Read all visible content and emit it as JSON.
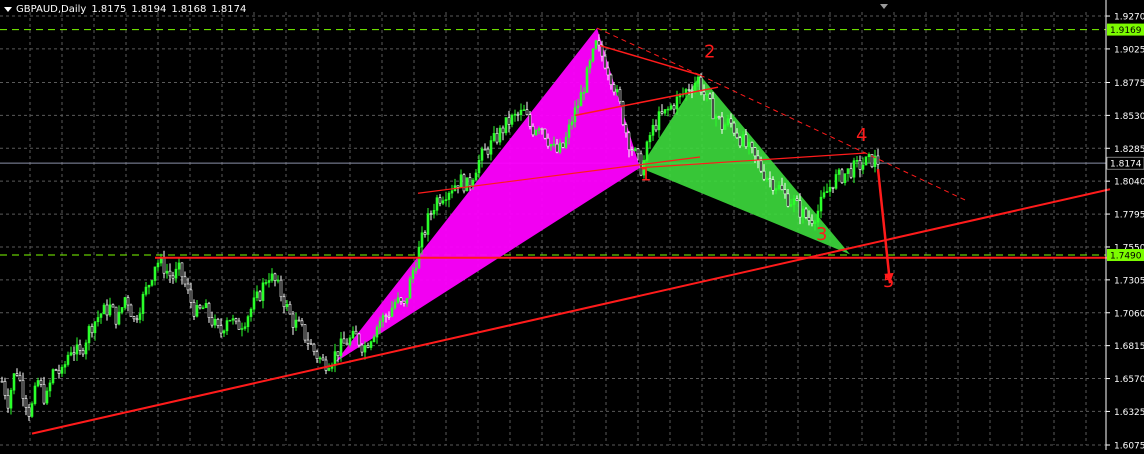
{
  "header": {
    "symbol_tf": "GBPAUD,Daily",
    "open": "1.8175",
    "high": "1.8194",
    "low": "1.8168",
    "close": "1.8174"
  },
  "colors": {
    "background": "#000000",
    "grid": "#5a5a5a",
    "bull_candle": "#2bff2b",
    "bear_candle": "#ffffff",
    "trend_line": "#ff1b1b",
    "xabcd_pink": "#ff00ff",
    "xabcd_green": "#3ddc3d",
    "hline_green": "#7cfc00",
    "price_label": "#c8c8c8",
    "axis_text": "#ffffff"
  },
  "chart_data": {
    "type": "candlestick",
    "ylim": [
      1.6075,
      1.93
    ],
    "y_ticks": [
      "1.9270",
      "1.9025",
      "1.8775",
      "1.8530",
      "1.8285",
      "1.8040",
      "1.7795",
      "1.7550",
      "1.7305",
      "1.7060",
      "1.6815",
      "1.6570",
      "1.6325",
      "1.6075"
    ],
    "grid": true,
    "current_price": "1.8174",
    "price_levels": [
      {
        "label": "1.9169",
        "value": 1.9169,
        "style": "dashed"
      },
      {
        "label": "1.7490",
        "value": 1.749,
        "style": "dashed"
      }
    ],
    "close_path": [
      [
        0,
        1.66
      ],
      [
        8,
        1.64
      ],
      [
        16,
        1.665
      ],
      [
        22,
        1.65
      ],
      [
        30,
        1.63
      ],
      [
        38,
        1.655
      ],
      [
        46,
        1.64
      ],
      [
        54,
        1.665
      ],
      [
        62,
        1.66
      ],
      [
        70,
        1.68
      ],
      [
        80,
        1.675
      ],
      [
        90,
        1.695
      ],
      [
        100,
        1.705
      ],
      [
        110,
        1.71
      ],
      [
        118,
        1.7
      ],
      [
        126,
        1.72
      ],
      [
        134,
        1.7
      ],
      [
        142,
        1.715
      ],
      [
        150,
        1.73
      ],
      [
        156,
        1.745
      ],
      [
        164,
        1.74
      ],
      [
        172,
        1.732
      ],
      [
        180,
        1.738
      ],
      [
        188,
        1.72
      ],
      [
        196,
        1.705
      ],
      [
        204,
        1.71
      ],
      [
        212,
        1.7
      ],
      [
        220,
        1.69
      ],
      [
        228,
        1.705
      ],
      [
        236,
        1.695
      ],
      [
        244,
        1.7
      ],
      [
        252,
        1.71
      ],
      [
        260,
        1.72
      ],
      [
        268,
        1.735
      ],
      [
        276,
        1.728
      ],
      [
        284,
        1.715
      ],
      [
        292,
        1.7
      ],
      [
        300,
        1.695
      ],
      [
        308,
        1.685
      ],
      [
        316,
        1.675
      ],
      [
        324,
        1.668
      ],
      [
        332,
        1.672
      ],
      [
        340,
        1.68
      ],
      [
        348,
        1.685
      ],
      [
        356,
        1.688
      ],
      [
        364,
        1.68
      ],
      [
        372,
        1.69
      ],
      [
        380,
        1.7
      ],
      [
        388,
        1.705
      ],
      [
        396,
        1.715
      ],
      [
        404,
        1.71
      ],
      [
        412,
        1.735
      ],
      [
        420,
        1.755
      ],
      [
        428,
        1.775
      ],
      [
        436,
        1.79
      ],
      [
        444,
        1.795
      ],
      [
        452,
        1.8
      ],
      [
        460,
        1.805
      ],
      [
        468,
        1.8
      ],
      [
        476,
        1.815
      ],
      [
        484,
        1.825
      ],
      [
        492,
        1.832
      ],
      [
        500,
        1.84
      ],
      [
        508,
        1.848
      ],
      [
        516,
        1.852
      ],
      [
        524,
        1.855
      ],
      [
        532,
        1.842
      ],
      [
        540,
        1.848
      ],
      [
        548,
        1.835
      ],
      [
        556,
        1.825
      ],
      [
        564,
        1.83
      ],
      [
        572,
        1.85
      ],
      [
        580,
        1.865
      ],
      [
        588,
        1.885
      ],
      [
        596,
        1.905
      ],
      [
        604,
        1.895
      ],
      [
        612,
        1.88
      ],
      [
        620,
        1.86
      ],
      [
        628,
        1.835
      ],
      [
        636,
        1.822
      ],
      [
        642,
        1.812
      ],
      [
        650,
        1.838
      ],
      [
        658,
        1.85
      ],
      [
        666,
        1.855
      ],
      [
        674,
        1.862
      ],
      [
        682,
        1.868
      ],
      [
        690,
        1.875
      ],
      [
        698,
        1.88
      ],
      [
        706,
        1.865
      ],
      [
        714,
        1.855
      ],
      [
        722,
        1.845
      ],
      [
        730,
        1.848
      ],
      [
        738,
        1.838
      ],
      [
        746,
        1.83
      ],
      [
        754,
        1.822
      ],
      [
        762,
        1.812
      ],
      [
        770,
        1.805
      ],
      [
        778,
        1.8
      ],
      [
        786,
        1.792
      ],
      [
        794,
        1.788
      ],
      [
        802,
        1.78
      ],
      [
        810,
        1.775
      ],
      [
        818,
        1.782
      ],
      [
        826,
        1.795
      ],
      [
        834,
        1.805
      ],
      [
        842,
        1.808
      ],
      [
        850,
        1.812
      ],
      [
        858,
        1.815
      ],
      [
        866,
        1.818
      ],
      [
        874,
        1.82
      ],
      [
        880,
        1.8174
      ]
    ],
    "pattern": {
      "pink_triangle": [
        [
          335,
          1.669
        ],
        [
          597,
          1.918
        ],
        [
          640,
          1.814
        ]
      ],
      "green_triangle": [
        [
          640,
          1.814
        ],
        [
          700,
          1.883
        ],
        [
          850,
          1.7495
        ]
      ],
      "points": [
        {
          "label": "1",
          "x": 640,
          "y": 1.814,
          "text_x": 640,
          "text_y": 1.8045
        },
        {
          "label": "2",
          "x": 700,
          "y": 1.883,
          "text_x": 704,
          "text_y": 1.896
        },
        {
          "label": "3",
          "x": 850,
          "y": 1.7495,
          "text_x": 816,
          "text_y": 1.76
        },
        {
          "label": "4",
          "x": 866,
          "y": 1.825,
          "text_x": 856,
          "text_y": 1.834
        },
        {
          "label": "5",
          "x": 888,
          "y": 1.73,
          "text_x": 883,
          "text_y": 1.725
        }
      ]
    },
    "trend_lines": [
      {
        "from": [
          32,
          1.616
        ],
        "to": [
          1110,
          1.798
        ],
        "width": 2
      },
      {
        "from": [
          155,
          1.747
        ],
        "to": [
          1110,
          1.747
        ],
        "width": 2
      },
      {
        "from": [
          418,
          1.795
        ],
        "to": [
          700,
          1.822
        ],
        "width": 1.2
      },
      {
        "from": [
          575,
          1.853
        ],
        "to": [
          718,
          1.874
        ],
        "width": 1.5
      },
      {
        "from": [
          600,
          1.905
        ],
        "to": [
          700,
          1.883
        ],
        "width": 1.5
      },
      {
        "from": [
          640,
          1.814
        ],
        "to": [
          866,
          1.825
        ],
        "width": 1.2
      }
    ],
    "dashed_lines": [
      {
        "from": [
          597,
          1.918
        ],
        "to": [
          700,
          1.883
        ]
      },
      {
        "from": [
          700,
          1.883
        ],
        "to": [
          965,
          1.79
        ]
      }
    ],
    "arrow": {
      "from": [
        878,
        1.813
      ],
      "to": [
        890,
        1.728
      ]
    }
  }
}
